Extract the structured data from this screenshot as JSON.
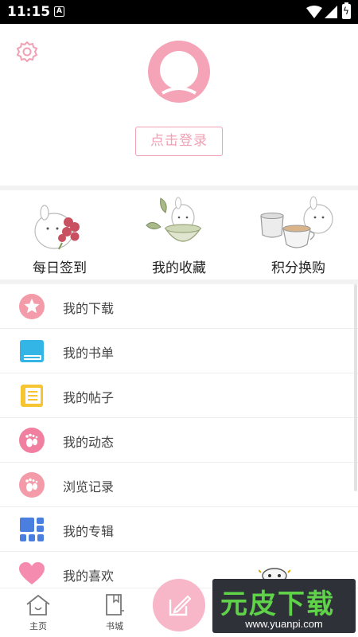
{
  "status_bar": {
    "time": "11:15",
    "notification_icon": "A"
  },
  "profile": {
    "login_label": "点击登录"
  },
  "quick_actions": [
    {
      "label": "每日签到",
      "icon": "bunny-flower-art"
    },
    {
      "label": "我的收藏",
      "icon": "bunny-bowl-art"
    },
    {
      "label": "积分换购",
      "icon": "bunny-teacup-art"
    }
  ],
  "menu": [
    {
      "label": "我的下载",
      "icon": "star-icon",
      "color": "#f49ba9"
    },
    {
      "label": "我的书单",
      "icon": "book-icon",
      "color": "#33b5e5"
    },
    {
      "label": "我的帖子",
      "icon": "note-icon",
      "color": "#f7c531"
    },
    {
      "label": "我的动态",
      "icon": "footprint-icon",
      "color": "#f07fa0"
    },
    {
      "label": "浏览记录",
      "icon": "footprint-icon",
      "color": "#f49ba9"
    },
    {
      "label": "我的专辑",
      "icon": "grid-icon",
      "color": "#4a7fe0"
    },
    {
      "label": "我的喜欢",
      "icon": "heart-icon",
      "color": "#f58cb0"
    }
  ],
  "bottom_nav": {
    "home_label": "主页",
    "store_label": "书城"
  },
  "watermark": {
    "brand": "元皮下载",
    "url": "www.yuanpi.com"
  },
  "colors": {
    "accent_pink": "#f2a0b4",
    "divider": "#f2f2f2"
  }
}
